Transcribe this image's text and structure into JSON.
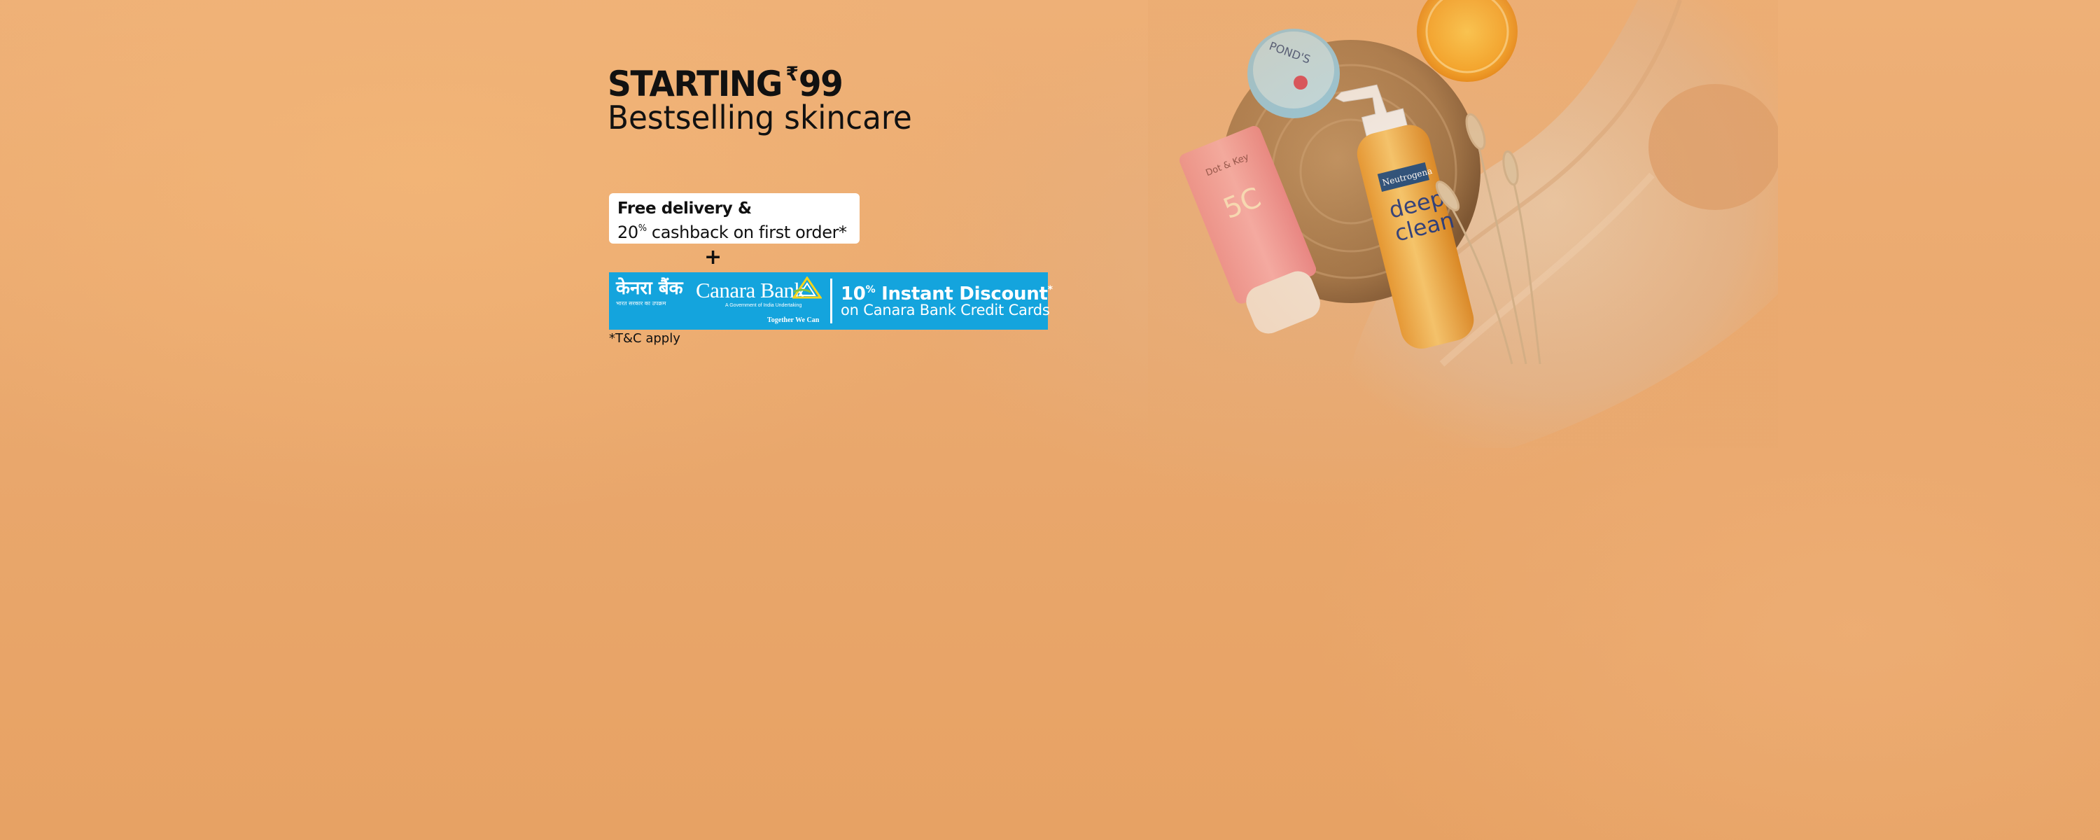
{
  "banner": {
    "headline_prefix": "STARTING",
    "currency_symbol": "₹",
    "headline_price": "99",
    "subheadline": "Bestselling skincare",
    "offer": {
      "line1": "Free delivery &",
      "percent_value": "20",
      "percent_sign": "%",
      "line2_rest": " cashback on first order*"
    },
    "plus_sign": "+",
    "bank": {
      "hindi_name": "केनरा बैंक",
      "hindi_tagline": "भारत सरकार का उपक्रम",
      "english_name": "Canara Bank",
      "gov_text": "A Government of India Undertaking",
      "tagline": "Together We Can",
      "discount_value": "10",
      "discount_percent_sign": "%",
      "discount_label": " Instant Discount",
      "discount_star": "*",
      "discount_subtitle": "on Canara Bank Credit Cards"
    },
    "tnc": "*T&C apply",
    "products": {
      "tube_brand": "Dot & Key",
      "tube_label": "5C",
      "jar_brand": "POND'S",
      "bottle_brand": "Neutrogena",
      "bottle_label_line1": "deep",
      "bottle_label_line2": "clean"
    }
  },
  "colors": {
    "background": "#eaa46a",
    "bank_blue": "#14a4dd",
    "text": "#111111"
  }
}
